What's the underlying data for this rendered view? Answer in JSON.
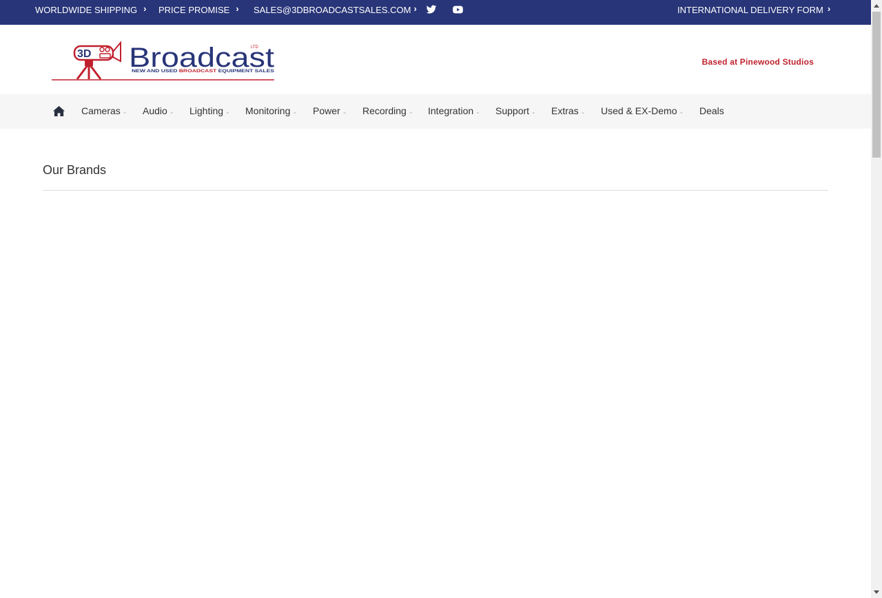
{
  "topbar": {
    "items": [
      {
        "label": "WORLDWIDE SHIPPING"
      },
      {
        "label": "PRICE PROMISE"
      },
      {
        "label": "SALES@3DBROADCASTSALES.COM"
      },
      {
        "label": "INTERNATIONAL DELIVERY FORM"
      }
    ],
    "social_icons": [
      "twitter-icon",
      "youtube-icon"
    ]
  },
  "header": {
    "logo": {
      "mark": "3D",
      "name": "Broadcast",
      "ltd": "LTD",
      "subline_part1": "NEW AND USED ",
      "subline_part2": "BROADCAST",
      "subline_part3": " EQUIPMENT SALES"
    },
    "tagline": "Based at Pinewood Studios"
  },
  "nav": {
    "home_icon": "home-icon",
    "items": [
      {
        "label": "Cameras",
        "has_dropdown": true
      },
      {
        "label": "Audio",
        "has_dropdown": true
      },
      {
        "label": "Lighting",
        "has_dropdown": true
      },
      {
        "label": "Monitoring",
        "has_dropdown": true
      },
      {
        "label": "Power",
        "has_dropdown": true
      },
      {
        "label": "Recording",
        "has_dropdown": true
      },
      {
        "label": "Integration",
        "has_dropdown": true
      },
      {
        "label": "Support",
        "has_dropdown": true
      },
      {
        "label": "Extras",
        "has_dropdown": true
      },
      {
        "label": "Used & EX-Demo",
        "has_dropdown": true
      },
      {
        "label": "Deals",
        "has_dropdown": false
      }
    ]
  },
  "main": {
    "section_title": "Our Brands"
  },
  "colors": {
    "topbar_bg": "#283578",
    "brand_blue": "#283578",
    "brand_red": "#c0202d",
    "nav_bg": "#f6f6f6"
  }
}
